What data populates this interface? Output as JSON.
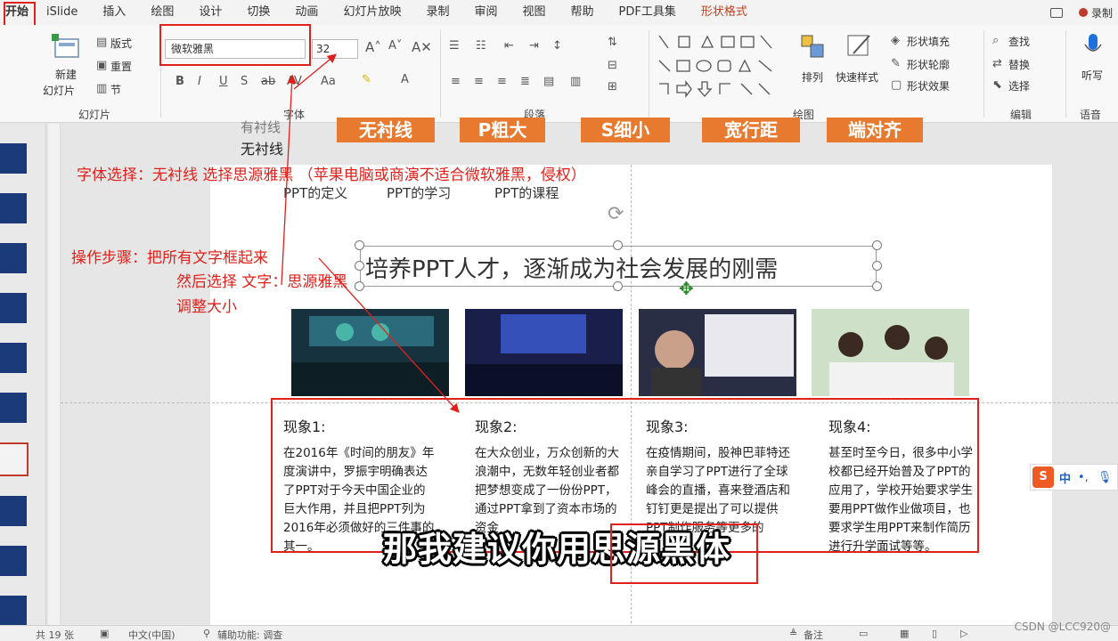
{
  "menu": {
    "items": [
      "开始",
      "iSlide",
      "插入",
      "绘图",
      "设计",
      "切换",
      "动画",
      "幻灯片放映",
      "录制",
      "审阅",
      "视图",
      "帮助",
      "PDF工具集",
      "形状格式"
    ],
    "record_label": "录制"
  },
  "ribbon": {
    "slides": {
      "new_slide": "新建",
      "new_slide2": "幻灯片",
      "layout": "版式",
      "reset": "重置",
      "section": "节",
      "label": "幻灯片"
    },
    "font": {
      "name": "微软雅黑",
      "size": "32",
      "label": "字体"
    },
    "paragraph": {
      "label": "段落"
    },
    "drawing": {
      "arrange": "排列",
      "quick_styles": "快速样式",
      "fill": "形状填充",
      "outline": "形状轮廓",
      "effects": "形状效果",
      "label": "绘图"
    },
    "editing": {
      "find": "查找",
      "replace": "替换",
      "select": "选择",
      "label": "编辑"
    },
    "voice": {
      "dictate": "听写",
      "label": "语音"
    }
  },
  "slide": {
    "partial_text_top": "有衬线",
    "sans_label": "无衬线",
    "orange_tags": [
      "无衬线",
      "P粗大",
      "S细小",
      "宽行距",
      "端对齐"
    ],
    "nav_links": [
      "PPT的定义",
      "PPT的学习",
      "PPT的课程"
    ],
    "title": "培养PPT人才，逐渐成为社会发展的刚需",
    "cards": [
      {
        "title": "现象1:",
        "body": "在2016年《时间的朋友》年度演讲中，罗振宇明确表达了PPT对于今天中国企业的巨大作用，并且把PPT列为2016年必须做好的三件事的其一。"
      },
      {
        "title": "现象2:",
        "body": "在大众创业，万众创新的大浪潮中，无数年轻创业者都把梦想变成了一份份PPT，通过PPT拿到了资本市场的资金"
      },
      {
        "title": "现象3:",
        "body": "在疫情期间，股神巴菲特还亲自学习了PPT进行了全球峰会的直播，喜来登酒店和钉钉更是提出了可以提供PPT制作服务等更多的"
      },
      {
        "title": "现象4:",
        "body": "甚至时至今日，很多中小学校都已经开始普及了PPT的应用了，学校开始要求学生要用PPT做作业做项目，也要求学生用PPT来制作简历进行升学面试等等。"
      }
    ]
  },
  "annotations": {
    "line1": "字体选择：无衬线 选择思源雅黑   （苹果电脑或商演不适合微软雅黑，侵权）",
    "line2": "操作步骤：把所有文字框起来",
    "line3": "然后选择 文字：思源雅黑",
    "line4": "调整大小"
  },
  "caption": "那我建议你用思源黑体",
  "ime": {
    "lang": "中"
  },
  "status": {
    "slide_count": "共 19 张",
    "language": "中文(中国)",
    "accessibility": "辅助功能: 调查",
    "notes": "备注"
  },
  "watermark": "CSDN @LCC920@",
  "colors": {
    "annotation_red": "#e0211b",
    "orange_tag": "#e77a2e",
    "accent": "#c43e1c"
  }
}
